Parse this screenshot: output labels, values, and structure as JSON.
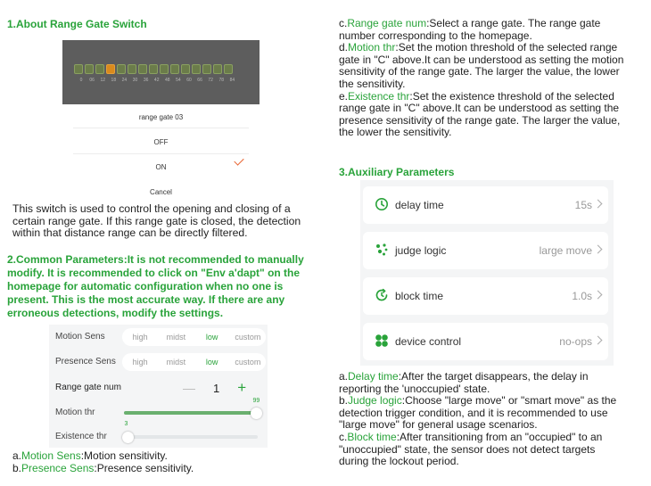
{
  "section1": {
    "heading": "1.About Range Gate Switch",
    "dialog": {
      "gate_numbers": [
        "0",
        "06",
        "12",
        "18",
        "24",
        "30",
        "36",
        "42",
        "48",
        "54",
        "60",
        "66",
        "72",
        "78",
        "84"
      ],
      "title": "range gate 03",
      "off": "OFF",
      "on": "ON",
      "cancel": "Cancel"
    },
    "lines": [
      "This switch is used to control the opening and closing of a",
      "certain range gate. If this range gate is closed, the detection",
      "within that distance range can be directly filtered."
    ]
  },
  "section2": {
    "heading_lines": [
      "2.Common Parameters:It is not recommended to manually",
      "modify. It is recommended to click on \"Env a'dapt\" on the",
      "homepage for automatic configuration when no one is",
      "present. This is the most accurate way. If there are any",
      "erroneous detections, modify the settings."
    ],
    "panel": {
      "motion_sens_label": "Motion Sens",
      "presence_sens_label": "Presence Sens",
      "options": [
        "high",
        "midst",
        "low",
        "custom"
      ],
      "selected_option": "low",
      "range_gate_label": "Range gate num",
      "range_gate_value": "1",
      "minus": "—",
      "plus": "+",
      "motion_thr_label": "Motion thr",
      "motion_thr_value": "99",
      "motion_thr_fraction": 0.99,
      "existence_thr_label": "Existence thr",
      "existence_thr_value": "3",
      "existence_thr_fraction": 0.03,
      "accent_color": "#29a33a"
    },
    "notes": [
      {
        "prefix": "a.",
        "key": "Motion Sens",
        "text": ":Motion sensitivity."
      },
      {
        "prefix": "b.",
        "key": "Presence Sens",
        "text": ":Presence sensitivity."
      }
    ]
  },
  "right_top": {
    "items": [
      {
        "prefix": "c.",
        "key": "Range gate num",
        "rest": [
          ":Select a range gate. The range gate",
          "number corresponding to the homepage."
        ]
      },
      {
        "prefix": "d.",
        "key": "Motion thr",
        "rest": [
          ":Set the motion threshold of the selected range",
          "gate in \"C\" above.It can be understood as setting the motion",
          "sensitivity of the range gate. The larger the value, the lower",
          "the sensitivity."
        ]
      },
      {
        "prefix": "e.",
        "key": "Existence thr",
        "rest": [
          ":Set the existence threshold of the selected",
          "range gate in \"C\" above.It can be understood as setting the",
          "presence sensitivity of the range gate. The larger the value,",
          "the lower the sensitivity."
        ]
      }
    ]
  },
  "section3": {
    "heading": "3.Auxiliary Parameters",
    "cards": [
      {
        "name": "delay time",
        "value": "15s",
        "icon": "clock-icon"
      },
      {
        "name": "judge logic",
        "value": "large move",
        "icon": "dots-cluster-icon"
      },
      {
        "name": "block time",
        "value": "1.0s",
        "icon": "refresh-clock-icon"
      },
      {
        "name": "device control",
        "value": "no-ops",
        "icon": "four-petal-icon"
      }
    ],
    "notes": [
      {
        "prefix": "a.",
        "key": "Delay time",
        "rest": [
          ":After the target disappears, the delay in",
          "reporting the 'unoccupied' state."
        ]
      },
      {
        "prefix": "b.",
        "key": "Judge logic",
        "rest": [
          ":Choose \"large move\" or \"smart move\" as the",
          "detection trigger condition, and it is recommended to use",
          "\"large move\" for general usage scenarios."
        ]
      },
      {
        "prefix": "c.",
        "key": "Block time",
        "rest": [
          ":After transitioning from an \"occupied\" to an",
          "\"unoccupied\" state, the sensor does not detect targets",
          "during the lockout period."
        ]
      }
    ]
  }
}
